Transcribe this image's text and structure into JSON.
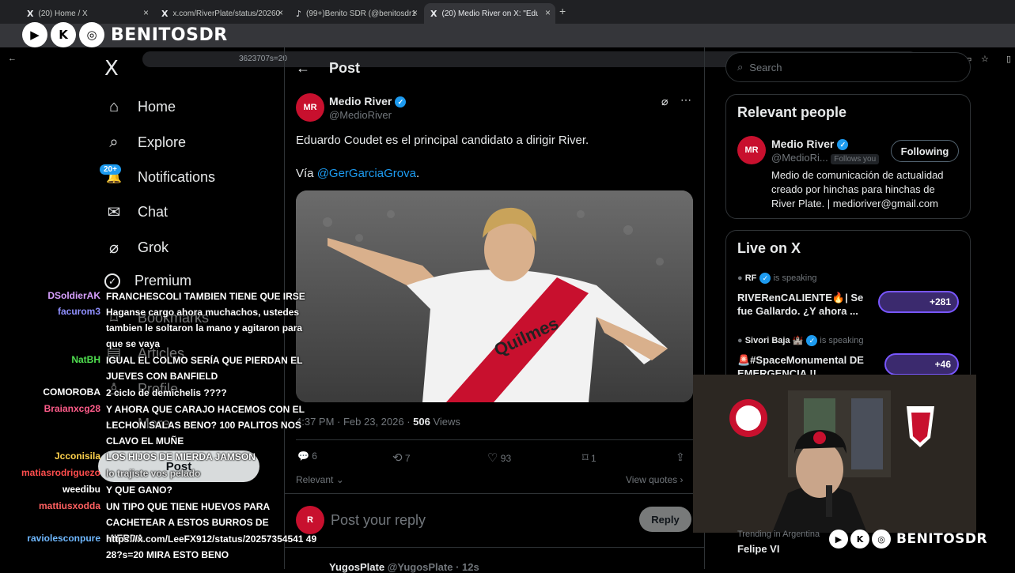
{
  "browser": {
    "tabs": [
      {
        "icon": "X",
        "title": "(20) Home / X"
      },
      {
        "icon": "X",
        "title": "x.com/RiverPlate/status/20260"
      },
      {
        "icon": "♪",
        "title": "(99+)Benito SDR (@benitosdr1"
      },
      {
        "icon": "X",
        "title": "(20) Medio River on X: \"Eduard"
      }
    ],
    "new_tab": "+",
    "url": "3623707s=20"
  },
  "overlay": {
    "brand": "BENITOSDR",
    "icons": [
      "▶",
      "K",
      "◎"
    ]
  },
  "nav": {
    "logo": "X",
    "badge": "20+",
    "items": [
      {
        "label": "Home",
        "icon": "⌂"
      },
      {
        "label": "Explore",
        "icon": "⌕"
      },
      {
        "label": "Notifications",
        "icon": "🔔"
      },
      {
        "label": "Chat",
        "icon": "✉"
      },
      {
        "label": "Grok",
        "icon": "⌀"
      },
      {
        "label": "Premium",
        "icon": "✓"
      },
      {
        "label": "Bookmarks",
        "icon": "⌑"
      },
      {
        "label": "Articles",
        "icon": "▤"
      },
      {
        "label": "Profile",
        "icon": "♙"
      },
      {
        "label": "More",
        "icon": "⋯"
      }
    ],
    "post_button": "Post"
  },
  "post": {
    "header": "Post",
    "author_name": "Medio River",
    "author_handle": "@MedioRiver",
    "text": "Eduardo Coudet es el principal candidato a dirigir River.",
    "via": "Vía",
    "via_link": "@GerGarciaGrova",
    "via_end": ".",
    "time": "4:37 PM · Feb 23, 2026 ·",
    "views_count": "506",
    "views_label": "Views",
    "replies": "6",
    "reposts": "7",
    "likes": "93",
    "bookmarks": "1",
    "sort_label": "Relevant",
    "view_quotes": "View quotes",
    "reply_placeholder": "Post your reply",
    "reply_button": "Reply",
    "next_name": "YugosPlate",
    "next_handle": "@YugosPlate · 12s"
  },
  "sidebar": {
    "search_placeholder": "Search",
    "relevant_title": "Relevant people",
    "person_name": "Medio River",
    "person_handle": "@MedioRi...",
    "follows_you": "Follows you",
    "following": "Following",
    "bio": "Medio de comunicación de actualidad creado por hinchas para hinchas de River Plate. | medioriver@gmail.com",
    "live_title": "Live on X",
    "spaces": [
      {
        "host": "RF",
        "status": "is speaking",
        "title": "RIVERenCALIENTE🔥| Se fue Gallardo. ¿Y ahora ...",
        "count": "+281"
      },
      {
        "host": "Sivori Baja 🏰",
        "status": "is speaking",
        "title": "🚨#SpaceMonumental DE EMERGENCIA !!",
        "count": "+46"
      }
    ],
    "trending_label": "Trending in Argentina",
    "trending_topic": "Felipe VI"
  },
  "chat": [
    {
      "user": "DSoldierAK",
      "color": "#d8a0ff",
      "text": "FRANCHESCOLI TAMBIEN TIENE QUE IRSE"
    },
    {
      "user": "facurom3",
      "color": "#9090ff",
      "text": "Haganse cargo ahora muchachos, ustedes tambien le soltaron la mano y agitaron para que se vaya"
    },
    {
      "user": "NatBH",
      "color": "#50e050",
      "text": "IGUAL EL COLMO SERÍA QUE PIERDAN EL JUEVES CON BANFIELD"
    },
    {
      "user": "COMOROBA",
      "color": "#ffffff",
      "text": "2 ciclo de demichelis ????"
    },
    {
      "user": "Braianxcg28",
      "color": "#ff5c8a",
      "text": "Y AHORA QUE CARAJO HACEMOS CON EL LECHON SALAS BENO? 100 PALITOS NOS CLAVO EL MUÑE"
    },
    {
      "user": "Jcconisila",
      "color": "#ffd24d",
      "text": "LOS HIJOS DE MIERDA JAMSON"
    },
    {
      "user": "matiasrodriguezo",
      "color": "#ff4d4d",
      "text": "lo trajiste vos pelado"
    },
    {
      "user": "weedibu",
      "color": "#ffffff",
      "text": "Y QUE GANO?"
    },
    {
      "user": "mattiusxodda",
      "color": "#ff6060",
      "text": "UN TIPO QUE TIENE HUEVOS PARA CACHETEAR A ESTOS BURROS DE MIERDA"
    },
    {
      "user": "raviolesconpure",
      "color": "#6fb8ff",
      "text": "https://x.com/LeeFX912/status/20257354541 4928?s=20 MIRA ESTO BENO"
    }
  ],
  "colors": {
    "accent": "#1d9bf0",
    "river_red": "#c8102e",
    "bg": "#000000"
  }
}
